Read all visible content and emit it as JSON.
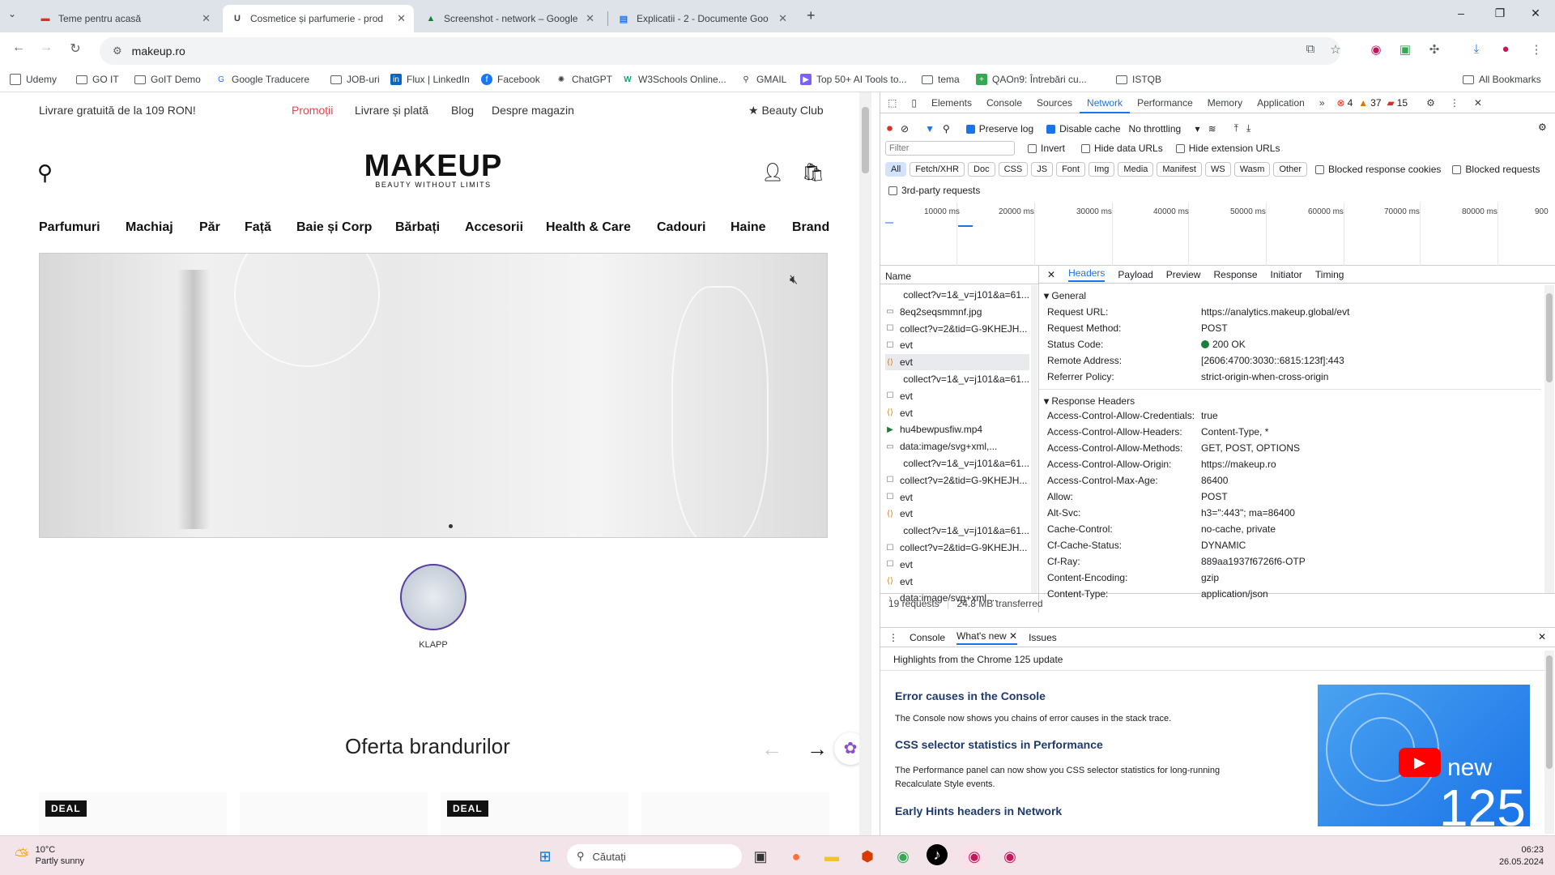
{
  "tabs": [
    {
      "title": "Teme pentru acasă",
      "icon": "classroom-icon",
      "active": false
    },
    {
      "title": "Cosmetice și parfumerie - prod",
      "icon": "makeup-icon",
      "active": true
    },
    {
      "title": "Screenshot - network – Google",
      "icon": "drive-icon",
      "active": false
    },
    {
      "title": "Explicatii - 2 - Documente Goo",
      "icon": "docs-icon",
      "active": false
    }
  ],
  "window_controls": {
    "minimize": "–",
    "restore": "❐",
    "close": "✕"
  },
  "url": "makeup.ro",
  "bookmarks": [
    "Udemy",
    "GO IT",
    "GoIT Demo",
    "Google Traducere",
    "JOB-uri",
    "Flux | LinkedIn",
    "Facebook",
    "ChatGPT",
    "W3Schools Online...",
    "GMAIL",
    "Top 50+ AI Tools to...",
    "tema",
    "QAOn9: Întrebări cu...",
    "ISTQB",
    "All Bookmarks"
  ],
  "site": {
    "promo": "Livrare gratuită de la 109 RON!",
    "toplinks": [
      "Promoții",
      "Livrare și plată",
      "Blog",
      "Despre magazin"
    ],
    "beauty_club": "Beauty Club",
    "logo": "MAKEUP",
    "tagline": "BEAUTY WITHOUT LIMITS",
    "menu": [
      "Parfumuri",
      "Machiaj",
      "Păr",
      "Față",
      "Baie și Corp",
      "Bărbați",
      "Accesorii",
      "Health & Care",
      "Cadouri",
      "Haine",
      "Brand"
    ],
    "story_label": "KLAPP",
    "offer_title": "Oferta brandurilor",
    "deal_badge": "DEAL"
  },
  "devtools": {
    "tabs": [
      "Elements",
      "Console",
      "Sources",
      "Network",
      "Performance",
      "Memory",
      "Application"
    ],
    "selected_tab": "Network",
    "errors": "4",
    "warnings": "37",
    "issues": "15",
    "preserve_log": "Preserve log",
    "disable_cache": "Disable cache",
    "throttling": "No throttling",
    "filter_placeholder": "Filter",
    "invert": "Invert",
    "hide_data_urls": "Hide data URLs",
    "hide_ext_urls": "Hide extension URLs",
    "type_filters": [
      "All",
      "Fetch/XHR",
      "Doc",
      "CSS",
      "JS",
      "Font",
      "Img",
      "Media",
      "Manifest",
      "WS",
      "Wasm",
      "Other"
    ],
    "blocked_cookies": "Blocked response cookies",
    "blocked_requests": "Blocked requests",
    "third_party": "3rd-party requests",
    "timeline_labels": [
      "10000 ms",
      "20000 ms",
      "30000 ms",
      "40000 ms",
      "50000 ms",
      "60000 ms",
      "70000 ms",
      "80000 ms",
      "900"
    ],
    "name_header": "Name",
    "requests": [
      {
        "name": "collect?v=1&_v=j101&a=61...",
        "icon": ""
      },
      {
        "name": "8eq2seqsmmnf.jpg",
        "icon": "img"
      },
      {
        "name": "collect?v=2&tid=G-9KHEJH...",
        "icon": "box"
      },
      {
        "name": "evt",
        "icon": "box"
      },
      {
        "name": "evt",
        "icon": "fetch",
        "selected": true
      },
      {
        "name": "collect?v=1&_v=j101&a=61...",
        "icon": ""
      },
      {
        "name": "evt",
        "icon": "box"
      },
      {
        "name": "evt",
        "icon": "fetch"
      },
      {
        "name": "hu4bewpusfiw.mp4",
        "icon": "media"
      },
      {
        "name": "data:image/svg+xml,...",
        "icon": "img"
      },
      {
        "name": "collect?v=1&_v=j101&a=61...",
        "icon": ""
      },
      {
        "name": "collect?v=2&tid=G-9KHEJH...",
        "icon": "box"
      },
      {
        "name": "evt",
        "icon": "box"
      },
      {
        "name": "evt",
        "icon": "fetch"
      },
      {
        "name": "collect?v=1&_v=j101&a=61...",
        "icon": ""
      },
      {
        "name": "collect?v=2&tid=G-9KHEJH...",
        "icon": "box"
      },
      {
        "name": "evt",
        "icon": "box"
      },
      {
        "name": "evt",
        "icon": "fetch"
      },
      {
        "name": "data:image/svg+xml,...",
        "icon": "expand"
      }
    ],
    "summary_requests": "19 requests",
    "summary_transferred": "24.8 MB transferred",
    "detail_tabs": [
      "Headers",
      "Payload",
      "Preview",
      "Response",
      "Initiator",
      "Timing"
    ],
    "general_title": "General",
    "general": [
      {
        "k": "Request URL:",
        "v": "https://analytics.makeup.global/evt"
      },
      {
        "k": "Request Method:",
        "v": "POST"
      },
      {
        "k": "Status Code:",
        "v": "200 OK"
      },
      {
        "k": "Remote Address:",
        "v": "[2606:4700:3030::6815:123f]:443"
      },
      {
        "k": "Referrer Policy:",
        "v": "strict-origin-when-cross-origin"
      }
    ],
    "response_title": "Response Headers",
    "response": [
      {
        "k": "Access-Control-Allow-Credentials:",
        "v": "true"
      },
      {
        "k": "Access-Control-Allow-Headers:",
        "v": "Content-Type, *"
      },
      {
        "k": "Access-Control-Allow-Methods:",
        "v": "GET, POST, OPTIONS"
      },
      {
        "k": "Access-Control-Allow-Origin:",
        "v": "https://makeup.ro"
      },
      {
        "k": "Access-Control-Max-Age:",
        "v": "86400"
      },
      {
        "k": "Allow:",
        "v": "POST"
      },
      {
        "k": "Alt-Svc:",
        "v": "h3=\":443\"; ma=86400"
      },
      {
        "k": "Cache-Control:",
        "v": "no-cache, private"
      },
      {
        "k": "Cf-Cache-Status:",
        "v": "DYNAMIC"
      },
      {
        "k": "Cf-Ray:",
        "v": "889aa1937f6726f6-OTP"
      },
      {
        "k": "Content-Encoding:",
        "v": "gzip"
      },
      {
        "k": "Content-Type:",
        "v": "application/json"
      }
    ],
    "drawer_tabs": [
      "Console",
      "What's new",
      "Issues"
    ],
    "drawer_highlight": "Highlights from the Chrome 125 update",
    "whatsnew": [
      {
        "title": "Error causes in the Console",
        "body": "The Console now shows you chains of error causes in the stack trace."
      },
      {
        "title": "CSS selector statistics in Performance",
        "body": "The Performance panel can now show you CSS selector statistics for long-running Recalculate Style events."
      },
      {
        "title": "Early Hints headers in Network",
        "body": ""
      }
    ],
    "promo_new": "new",
    "promo_version": "125"
  },
  "taskbar": {
    "temp": "10°C",
    "weather": "Partly sunny",
    "search": "Căutați",
    "time": "06:23",
    "date": "26.05.2024"
  }
}
